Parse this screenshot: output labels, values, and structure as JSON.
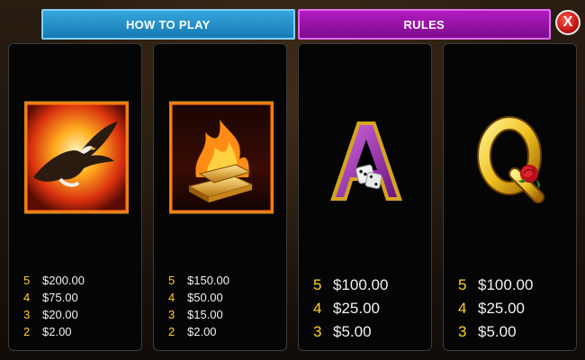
{
  "tabs": {
    "how_to_play": "HOW TO PLAY",
    "rules": "RULES"
  },
  "close": {
    "icon": "close-icon",
    "glyph": "X"
  },
  "colors": {
    "tab_how": "#1679b4",
    "tab_rules": "#8a0f9a",
    "pay_count": "#ffd21e",
    "pay_amount": "#f2f2f2"
  },
  "panels": [
    {
      "symbol": "eagle-icon",
      "pays": [
        {
          "count": "5",
          "amount": "$200.00"
        },
        {
          "count": "4",
          "amount": "$75.00"
        },
        {
          "count": "3",
          "amount": "$20.00"
        },
        {
          "count": "2",
          "amount": "$2.00"
        }
      ]
    },
    {
      "symbol": "gold-bars-fire-icon",
      "pays": [
        {
          "count": "5",
          "amount": "$150.00"
        },
        {
          "count": "4",
          "amount": "$50.00"
        },
        {
          "count": "3",
          "amount": "$15.00"
        },
        {
          "count": "2",
          "amount": "$2.00"
        }
      ]
    },
    {
      "symbol": "ace-dice-icon",
      "pays": [
        {
          "count": "5",
          "amount": "$100.00"
        },
        {
          "count": "4",
          "amount": "$25.00"
        },
        {
          "count": "3",
          "amount": "$5.00"
        }
      ]
    },
    {
      "symbol": "queen-rose-icon",
      "pays": [
        {
          "count": "5",
          "amount": "$100.00"
        },
        {
          "count": "4",
          "amount": "$25.00"
        },
        {
          "count": "3",
          "amount": "$5.00"
        }
      ]
    }
  ]
}
